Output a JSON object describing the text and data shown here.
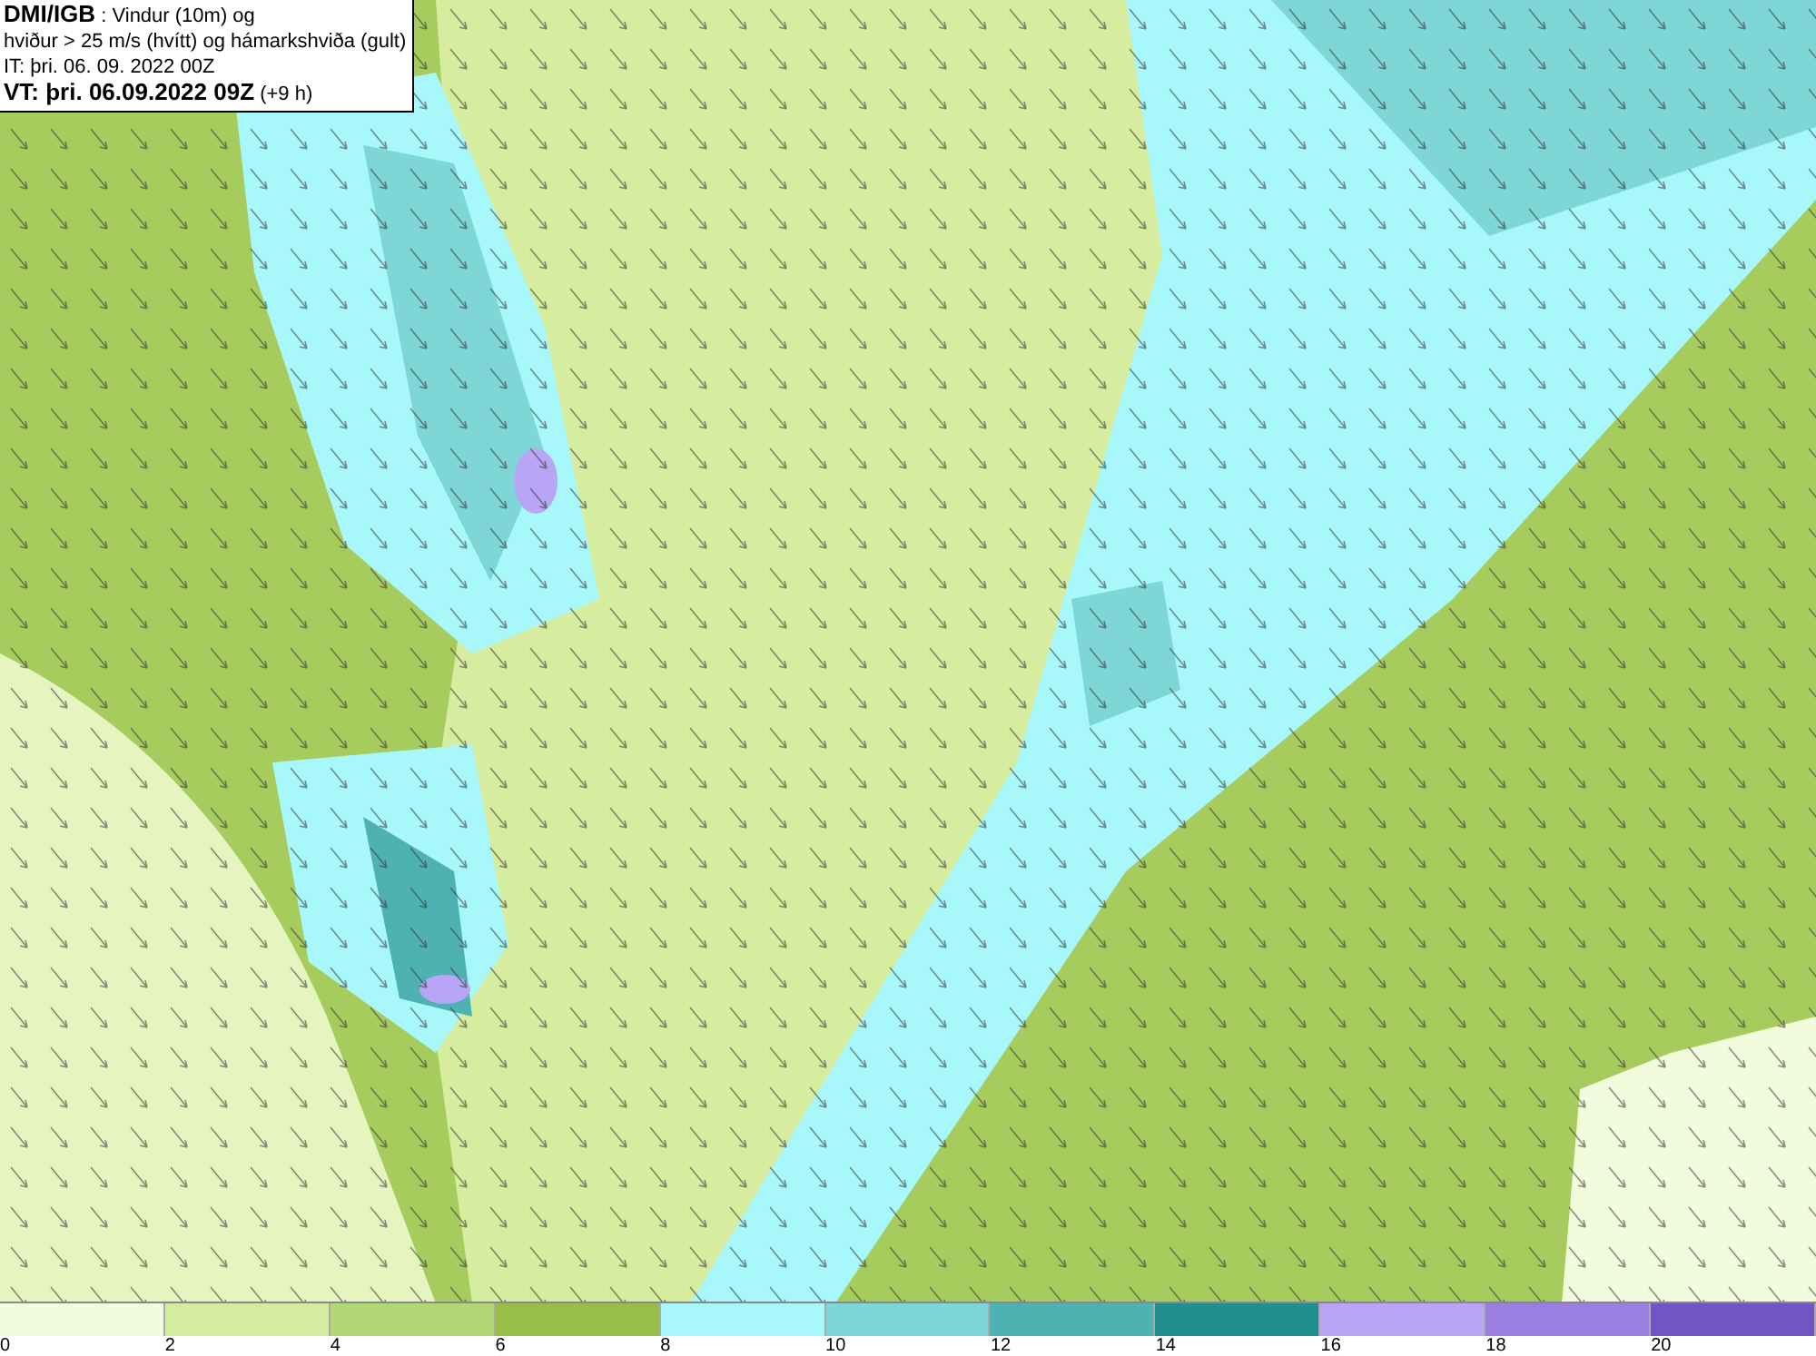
{
  "title_box": {
    "lines": [
      "**DMI/IGB** : Vindur (10m) og",
      "hviður > 25 m/s (hvítt) og hámarkshviða (gult)",
      "IT: þri. 06. 09. 2022 00Z",
      "**VT: þri. 06.09.2022 09Z** (+9 h)"
    ]
  },
  "legend": {
    "bins": [
      {
        "label": "0",
        "color": "#f2fbdc"
      },
      {
        "label": "2",
        "color": "#d4eca0"
      },
      {
        "label": "4",
        "color": "#b4d775"
      },
      {
        "label": "6",
        "color": "#97bf47"
      },
      {
        "label": "8",
        "color": "#a8f8fb"
      },
      {
        "label": "10",
        "color": "#7fd6d6"
      },
      {
        "label": "12",
        "color": "#4fb2b2"
      },
      {
        "label": "14",
        "color": "#218f8f"
      },
      {
        "label": "16",
        "color": "#b9a5f5"
      },
      {
        "label": "18",
        "color": "#9a7fe0"
      },
      {
        "label": "20",
        "color": "#7254c4"
      }
    ]
  }
}
